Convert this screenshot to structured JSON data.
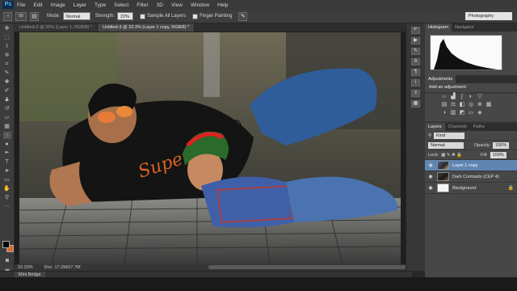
{
  "menubar": {
    "logo": "Ps",
    "items": [
      "File",
      "Edit",
      "Image",
      "Layer",
      "Type",
      "Select",
      "Filter",
      "3D",
      "View",
      "Window",
      "Help"
    ]
  },
  "options": {
    "brush_size": "50",
    "mode_label": "Mode:",
    "mode_value": "Normal",
    "strength_label": "Strength:",
    "strength_value": "22%",
    "sample_all_label": "Sample All Layers",
    "finger_painting_label": "Finger Painting",
    "workspace": "Photography"
  },
  "tabs": [
    {
      "label": "Untitled-2 @ 25% (Layer 1, RGB/8) *",
      "active": false
    },
    {
      "label": "Untitled-3 @ 33.3% (Layer 1 copy, RGB/8) *",
      "active": true
    }
  ],
  "status": {
    "zoom": "33.33%",
    "doc": "Doc: 17.2M/37.7M"
  },
  "mini_bridge": "Mini Bridge",
  "panels": {
    "histogram_tab": "Histogram",
    "navigator_tab": "Navigator",
    "adjustments_tab": "Adjustments",
    "adjustments_heading": "Add an adjustment",
    "layers_tab": "Layers",
    "channels_tab": "Channels",
    "paths_tab": "Paths",
    "kind": "Kind",
    "blend_mode": "Normal",
    "opacity_label": "Opacity:",
    "opacity_value": "100%",
    "lock_label": "Lock:",
    "fill_label": "Fill:",
    "fill_value": "100%"
  },
  "layers": [
    {
      "name": "Layer 1 copy",
      "selected": true
    },
    {
      "name": "Dark Contrasts (CEP 4)",
      "selected": false
    },
    {
      "name": "Background",
      "selected": false
    }
  ],
  "colors": {
    "accent_selected_layer": "#5f86b3",
    "background_swatch": "#e06a21",
    "foreground_swatch": "#000000"
  }
}
